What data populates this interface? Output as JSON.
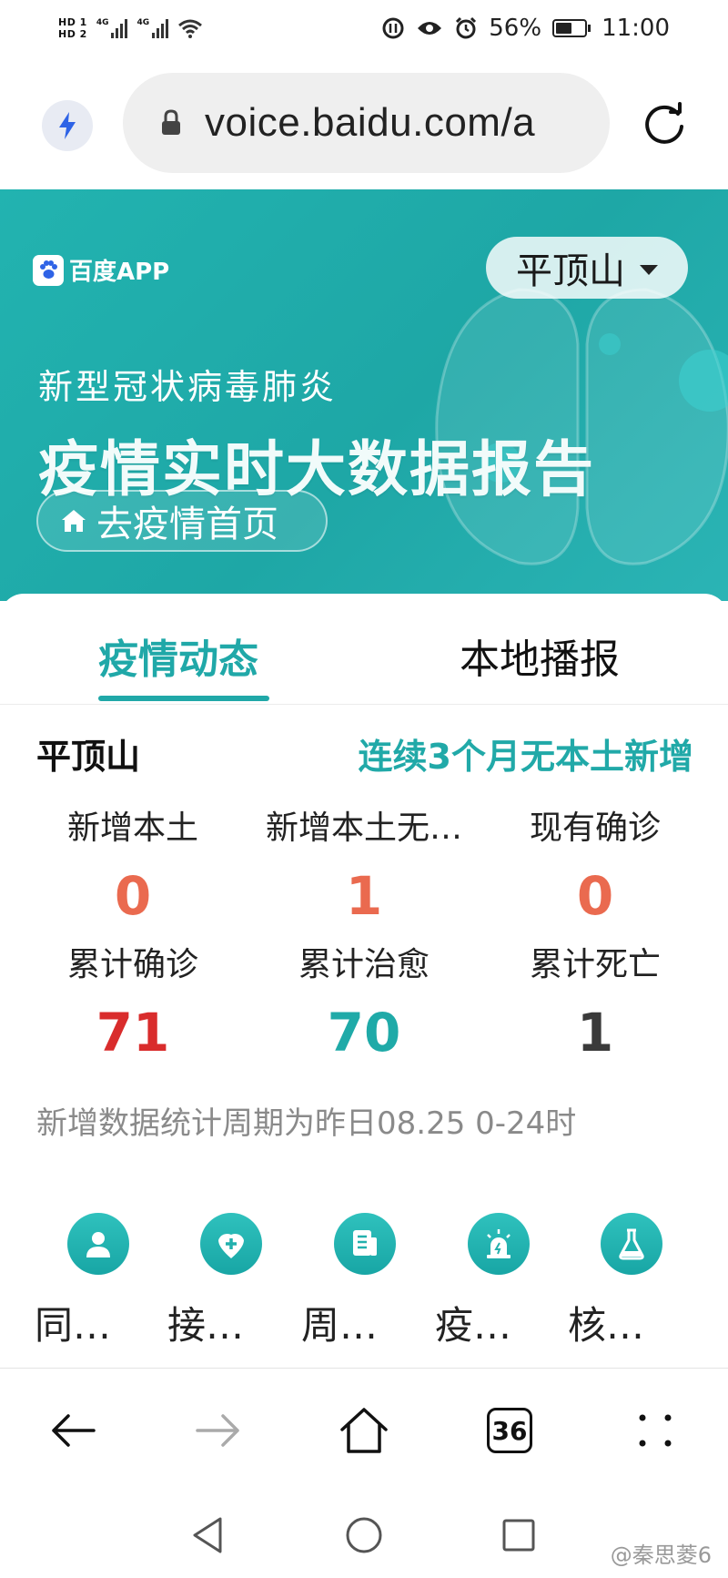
{
  "status_bar": {
    "hd1": "HD 1",
    "hd2": "HD 2",
    "net1": "4G",
    "net2": "4G",
    "battery_pct": "56%",
    "battery_level": 0.56,
    "time": "11:00"
  },
  "address_bar": {
    "url": "voice.baidu.com/a"
  },
  "banner": {
    "logo_text": "百度APP",
    "city": "平顶山",
    "subtitle": "新型冠状病毒肺炎",
    "title": "疫情实时大数据报告",
    "home_link": "去疫情首页"
  },
  "tabs": [
    {
      "label": "疫情动态",
      "active": true
    },
    {
      "label": "本地播报",
      "active": false
    }
  ],
  "region": {
    "name": "平顶山",
    "note": "连续3个月无本土新增"
  },
  "stats": [
    {
      "label": "新增本土",
      "value": "0"
    },
    {
      "label": "新增本土无…",
      "value": "1"
    },
    {
      "label": "现有确诊",
      "value": "0"
    },
    {
      "label": "累计确诊",
      "value": "71"
    },
    {
      "label": "累计治愈",
      "value": "70"
    },
    {
      "label": "累计死亡",
      "value": "1"
    }
  ],
  "stats_note": "新增数据统计周期为昨日08.25 0-24时",
  "quick_links": [
    {
      "label": "同…",
      "icon": "person-icon"
    },
    {
      "label": "接…",
      "icon": "medical-plus-icon"
    },
    {
      "label": "周…",
      "icon": "document-icon"
    },
    {
      "label": "疫…",
      "icon": "alarm-light-icon"
    },
    {
      "label": "核…",
      "icon": "flask-icon"
    }
  ],
  "toolbar": {
    "tab_count": "36"
  },
  "watermark": "@秦思菱6",
  "colors": {
    "teal": "#20a8a8",
    "orange": "#ea6a4f",
    "red": "#d92c2c",
    "dark": "#3a3a3a"
  }
}
